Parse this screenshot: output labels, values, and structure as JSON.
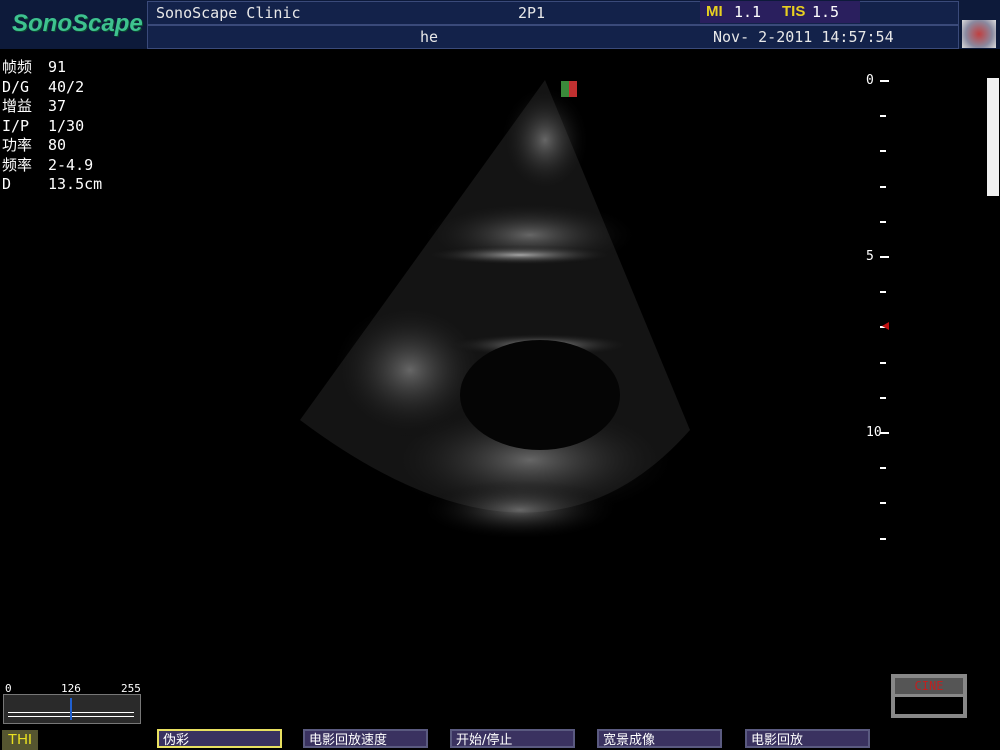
{
  "header": {
    "logo": "SonoScape",
    "clinic": "SonoScape Clinic",
    "probe": "2P1",
    "patient": "he",
    "mi_label": "MI",
    "mi_value": "1.1",
    "tis_label": "TIS",
    "tis_value": "1.5",
    "datetime": "Nov- 2-2011 14:57:54"
  },
  "params": [
    {
      "label": "帧频",
      "value": "91"
    },
    {
      "label": "D/G",
      "value": "40/2"
    },
    {
      "label": "增益",
      "value": "37"
    },
    {
      "label": "I/P",
      "value": "1/30"
    },
    {
      "label": "功率",
      "value": "80"
    },
    {
      "label": "频率",
      "value": "2-4.9"
    },
    {
      "label": "D",
      "value": "13.5cm"
    }
  ],
  "depth_scale": {
    "labels": [
      "0",
      "5",
      "10"
    ]
  },
  "gray_slider": {
    "min": "0",
    "mid": "126",
    "max": "255",
    "value": 126
  },
  "cine": {
    "label": "CINE"
  },
  "thi": "THI",
  "softkeys": [
    "伪彩",
    "电影回放速度",
    "开始/停止",
    "宽景成像",
    "电影回放"
  ],
  "colors": {
    "header": "#0d1a3a",
    "logo": "#3ec28f",
    "mi": "#e8d020",
    "selected": "#e8e060"
  }
}
